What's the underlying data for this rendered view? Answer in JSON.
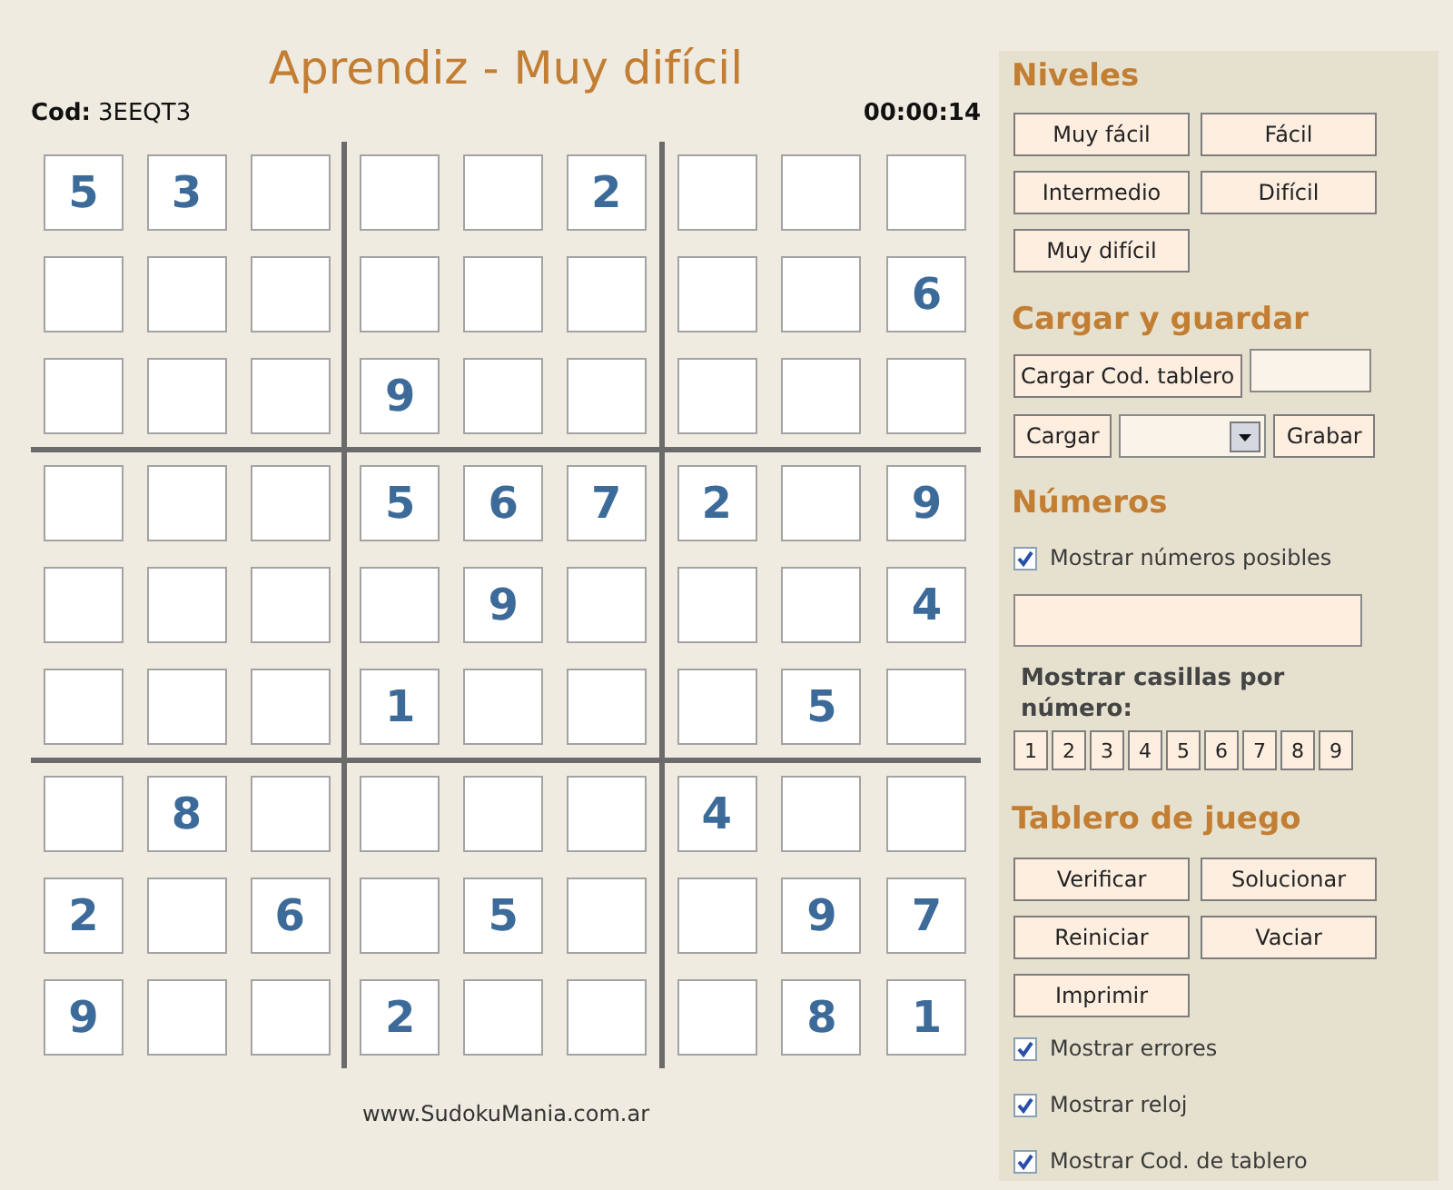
{
  "header": {
    "title": "Aprendiz - Muy difícil",
    "code_label": "Cod:",
    "code": "3EEQT3",
    "timer": "00:00:14"
  },
  "board": {
    "rows": [
      {
        "cells": [
          {
            "kind": "given",
            "value": "5"
          },
          {
            "kind": "given",
            "value": "3"
          },
          {
            "kind": "empty"
          },
          {
            "kind": "empty"
          },
          {
            "kind": "empty"
          },
          {
            "kind": "given",
            "value": "2"
          },
          {
            "kind": "empty"
          },
          {
            "kind": "empty"
          },
          {
            "kind": "empty"
          }
        ]
      },
      {
        "cells": [
          {
            "kind": "empty"
          },
          {
            "kind": "empty"
          },
          {
            "kind": "empty"
          },
          {
            "kind": "empty"
          },
          {
            "kind": "empty"
          },
          {
            "kind": "empty"
          },
          {
            "kind": "empty"
          },
          {
            "kind": "empty"
          },
          {
            "kind": "given",
            "value": "6"
          }
        ]
      },
      {
        "cells": [
          {
            "kind": "empty"
          },
          {
            "kind": "empty"
          },
          {
            "kind": "empty"
          },
          {
            "kind": "given",
            "value": "9"
          },
          {
            "kind": "empty"
          },
          {
            "kind": "empty"
          },
          {
            "kind": "empty"
          },
          {
            "kind": "empty"
          },
          {
            "kind": "empty"
          }
        ]
      },
      {
        "cells": [
          {
            "kind": "empty"
          },
          {
            "kind": "empty"
          },
          {
            "kind": "empty"
          },
          {
            "kind": "given",
            "value": "5"
          },
          {
            "kind": "given",
            "value": "6"
          },
          {
            "kind": "given",
            "value": "7"
          },
          {
            "kind": "given",
            "value": "2"
          },
          {
            "kind": "empty"
          },
          {
            "kind": "given",
            "value": "9"
          }
        ]
      },
      {
        "cells": [
          {
            "kind": "empty"
          },
          {
            "kind": "empty"
          },
          {
            "kind": "empty"
          },
          {
            "kind": "empty"
          },
          {
            "kind": "given",
            "value": "9"
          },
          {
            "kind": "empty"
          },
          {
            "kind": "empty"
          },
          {
            "kind": "empty"
          },
          {
            "kind": "given",
            "value": "4"
          }
        ]
      },
      {
        "cells": [
          {
            "kind": "empty"
          },
          {
            "kind": "empty"
          },
          {
            "kind": "empty"
          },
          {
            "kind": "given",
            "value": "1"
          },
          {
            "kind": "empty"
          },
          {
            "kind": "empty"
          },
          {
            "kind": "empty"
          },
          {
            "kind": "given",
            "value": "5"
          },
          {
            "kind": "empty"
          }
        ]
      },
      {
        "cells": [
          {
            "kind": "empty"
          },
          {
            "kind": "given",
            "value": "8"
          },
          {
            "kind": "empty"
          },
          {
            "kind": "empty"
          },
          {
            "kind": "empty"
          },
          {
            "kind": "empty"
          },
          {
            "kind": "given",
            "value": "4"
          },
          {
            "kind": "empty"
          },
          {
            "kind": "empty"
          }
        ]
      },
      {
        "cells": [
          {
            "kind": "given",
            "value": "2"
          },
          {
            "kind": "empty"
          },
          {
            "kind": "given",
            "value": "6"
          },
          {
            "kind": "empty"
          },
          {
            "kind": "given",
            "value": "5"
          },
          {
            "kind": "empty"
          },
          {
            "kind": "empty"
          },
          {
            "kind": "given",
            "value": "9"
          },
          {
            "kind": "given",
            "value": "7"
          }
        ]
      },
      {
        "cells": [
          {
            "kind": "given",
            "value": "9"
          },
          {
            "kind": "empty"
          },
          {
            "kind": "empty"
          },
          {
            "kind": "given",
            "value": "2"
          },
          {
            "kind": "empty"
          },
          {
            "kind": "empty"
          },
          {
            "kind": "empty"
          },
          {
            "kind": "given",
            "value": "8"
          },
          {
            "kind": "given",
            "value": "1"
          }
        ]
      }
    ]
  },
  "footer": {
    "url": "www.SudokuMania.com.ar"
  },
  "panel": {
    "levels": {
      "heading": "Niveles",
      "buttons": [
        "Muy fácil",
        "Fácil",
        "Intermedio",
        "Difícil",
        "Muy difícil"
      ]
    },
    "load_save": {
      "heading": "Cargar y guardar",
      "load_code_button": "Cargar Cod. tablero",
      "load_button": "Cargar",
      "save_button": "Grabar"
    },
    "numbers": {
      "heading": "Números",
      "show_possible": {
        "label": "Mostrar números posibles",
        "checked": true
      },
      "show_by_number_label": "Mostrar casillas por número:",
      "number_buttons": [
        "1",
        "2",
        "3",
        "4",
        "5",
        "6",
        "7",
        "8",
        "9"
      ]
    },
    "board_actions": {
      "heading": "Tablero de juego",
      "buttons": [
        "Verificar",
        "Solucionar",
        "Reiniciar",
        "Vaciar",
        "Imprimir"
      ],
      "options": [
        {
          "label": "Mostrar errores",
          "checked": true
        },
        {
          "label": "Mostrar reloj",
          "checked": true
        },
        {
          "label": "Mostrar Cod. de tablero",
          "checked": true
        }
      ]
    }
  }
}
